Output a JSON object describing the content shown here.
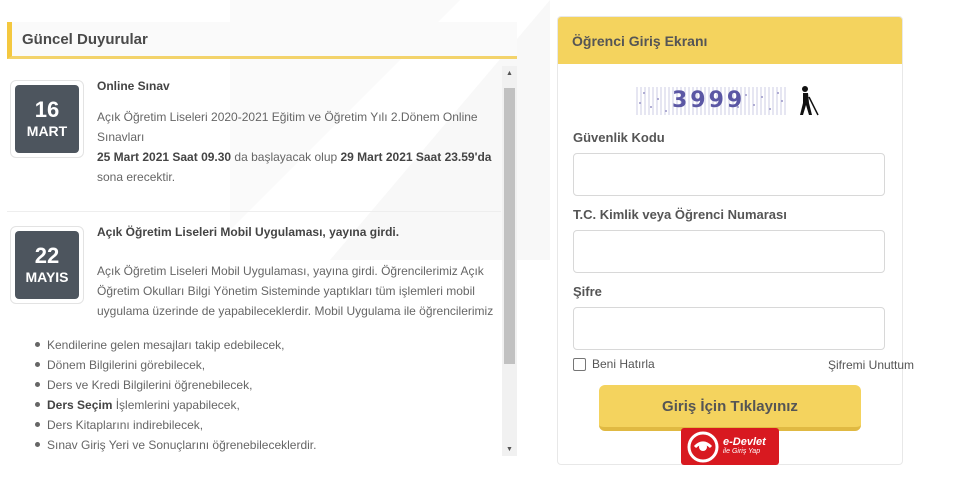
{
  "announcements": {
    "title": "Güncel Duyurular",
    "items": [
      {
        "day": "16",
        "month": "MART",
        "title": "Online Sınav",
        "lines": [
          "Açık Öğretim Liseleri 2020-2021 Eğitim ve Öğretim Yılı 2.Dönem Online",
          "Sınavları"
        ],
        "bold_start": "25 Mart 2021 Saat 09.30",
        "mid_text": " da başlayacak olup ",
        "bold_end": "29 Mart 2021 Saat 23.59'da",
        "last_line": "sona erecektir."
      },
      {
        "day": "22",
        "month": "MAYIS",
        "title": "Açık Öğretim Liseleri Mobil Uygulaması, yayına girdi.",
        "lines": [
          "Açık Öğretim Liseleri Mobil Uygulaması, yayına girdi. Öğrencilerimiz Açık",
          "Öğretim Okulları Bilgi Yönetim Sisteminde yaptıkları tüm işlemleri mobil",
          "uygulama üzerinde de yapabileceklerdir. Mobil Uygulama ile öğrencilerimiz"
        ],
        "bullets": [
          "Kendilerine gelen mesajları takip edebilecek,",
          "Dönem Bilgilerini görebilecek,",
          "Ders ve Kredi Bilgilerini öğrenebilecek,",
          "İşlemlerini yapabilecek,",
          "Ders Kitaplarını indirebilecek,",
          "Sınav Giriş Yeri ve Sonuçlarını öğrenebileceklerdir."
        ],
        "bullet_bold_prefix": "Ders Seçim"
      }
    ]
  },
  "login": {
    "title": "Öğrenci Giriş Ekranı",
    "captcha_text": "3999",
    "security_code_label": "Güvenlik Kodu",
    "id_label": "T.C. Kimlik veya Öğrenci Numarası",
    "password_label": "Şifre",
    "remember_label": "Beni Hatırla",
    "forgot_label": "Şifremi Unuttum",
    "submit_label": "Giriş İçin Tıklayınız",
    "edevlet_label": "e-Devlet",
    "edevlet_sub": "ile Giriş Yap"
  },
  "colors": {
    "accent": "#f4d35e",
    "date_box": "#4d555e",
    "edevlet": "#d81920"
  }
}
